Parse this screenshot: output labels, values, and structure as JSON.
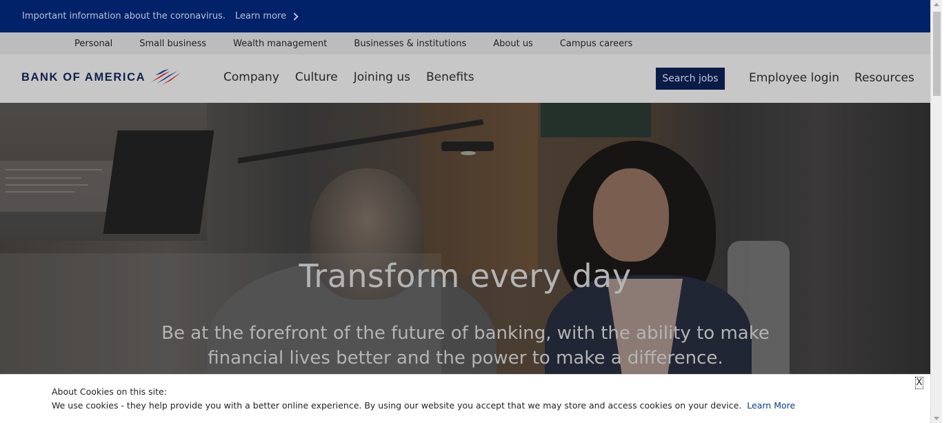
{
  "alert": {
    "message": "Important information about the coronavirus.",
    "link_label": "Learn more"
  },
  "segment_nav": {
    "items": [
      {
        "label": "Personal"
      },
      {
        "label": "Small business"
      },
      {
        "label": "Wealth management"
      },
      {
        "label": "Businesses & institutions"
      },
      {
        "label": "About us"
      },
      {
        "label": "Campus careers"
      }
    ]
  },
  "header": {
    "logo_text": "BANK OF AMERICA",
    "nav": [
      {
        "label": "Company"
      },
      {
        "label": "Culture"
      },
      {
        "label": "Joining us"
      },
      {
        "label": "Benefits"
      }
    ],
    "search_jobs_label": "Search jobs",
    "employee_login_label": "Employee login",
    "resources_label": "Resources"
  },
  "hero": {
    "title": "Transform every day",
    "subtitle": "Be at the forefront of the future of banking, with the ability to make financial lives better and the power to make a difference."
  },
  "cookie": {
    "title": "About Cookies on this site:",
    "text": "We use cookies - they help provide you with a better online experience. By using our website you accept that we may store and access cookies on your device.",
    "link_label": "Learn More",
    "close_label": "X"
  },
  "colors": {
    "alert_bg": "#012169",
    "search_button_bg": "#0b1b47",
    "flag_red": "#b22234",
    "flag_blue": "#1a3b7a"
  },
  "icons": {
    "alert_link": "chevron-right-icon",
    "logo_mark": "flag-logo-icon"
  }
}
